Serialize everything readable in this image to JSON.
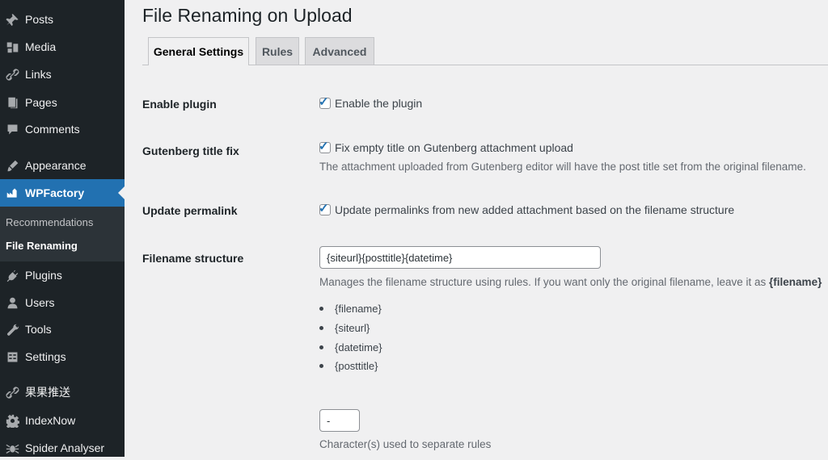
{
  "sidebar": {
    "items": [
      {
        "label": "Posts",
        "icon": "pin-icon"
      },
      {
        "label": "Media",
        "icon": "media-icon"
      },
      {
        "label": "Links",
        "icon": "link-icon"
      },
      {
        "label": "Pages",
        "icon": "pages-icon"
      },
      {
        "label": "Comments",
        "icon": "comments-icon"
      },
      {
        "label": "Appearance",
        "icon": "appearance-icon"
      },
      {
        "label": "WPFactory",
        "icon": "wpfactory-icon"
      },
      {
        "label": "Plugins",
        "icon": "plugins-icon"
      },
      {
        "label": "Users",
        "icon": "users-icon"
      },
      {
        "label": "Tools",
        "icon": "tools-icon"
      },
      {
        "label": "Settings",
        "icon": "settings-icon"
      },
      {
        "label": "果果推送",
        "icon": "link-icon"
      },
      {
        "label": "IndexNow",
        "icon": "gear-icon"
      },
      {
        "label": "Spider Analyser",
        "icon": "spider-icon"
      }
    ],
    "submenu": [
      "Recommendations",
      "File Renaming"
    ],
    "active_color": "#2271b1"
  },
  "page": {
    "title": "File Renaming on Upload",
    "tabs": [
      "General Settings",
      "Rules",
      "Advanced"
    ]
  },
  "settings": {
    "enable_plugin": {
      "label": "Enable plugin",
      "checkbox": "Enable the plugin",
      "checked": true
    },
    "gutenberg": {
      "label": "Gutenberg title fix",
      "checkbox": "Fix empty title on Gutenberg attachment upload",
      "description": "The attachment uploaded from Gutenberg editor will have the post title set from the original filename.",
      "checked": true
    },
    "permalink": {
      "label": "Update permalink",
      "checkbox": "Update permalinks from new added attachment based on the filename structure",
      "checked": true
    },
    "filename_structure": {
      "label": "Filename structure",
      "value": "{siteurl}{posttitle}{datetime}",
      "description": "Manages the filename structure using rules. If you want only the original filename, leave it as ",
      "description_bold": "{filename}",
      "rules": [
        "{filename}",
        "{siteurl}",
        "{datetime}",
        "{posttitle}"
      ]
    },
    "separator": {
      "value": "-",
      "description": "Character(s) used to separate rules"
    }
  }
}
